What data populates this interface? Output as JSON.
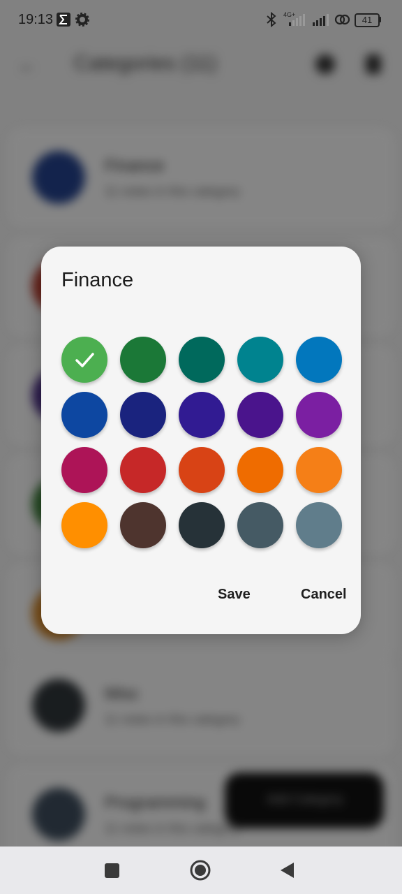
{
  "status_bar": {
    "time": "19:13",
    "battery_level": "41",
    "network_type": "4G+",
    "icons": [
      "sigma-icon",
      "gear-icon",
      "bluetooth-icon",
      "signal-icon",
      "signal-icon",
      "hotspot-icon",
      "battery-icon"
    ]
  },
  "background": {
    "title": "Categories (11)",
    "items": [
      {
        "name": "Finance",
        "subtitle": "11 notes in this category",
        "color": "#24418a"
      },
      {
        "name": "",
        "subtitle": "",
        "color": "#b63b2c"
      },
      {
        "name": "",
        "subtitle": "",
        "color": "#4a2d86"
      },
      {
        "name": "",
        "subtitle": "",
        "color": "#3d7f3a"
      },
      {
        "name": "",
        "subtitle": "",
        "color": "#d7892a"
      },
      {
        "name": "Misc",
        "subtitle": "11 notes in this category",
        "color": "#2f3539"
      },
      {
        "name": "Programming",
        "subtitle": "11 notes in this category",
        "color": "#3d4c5c"
      }
    ],
    "fab_label": "Add Category"
  },
  "dialog": {
    "title": "Finance",
    "selected_index": 0,
    "swatches": [
      "#4caf50",
      "#1b7837",
      "#00695c",
      "#00838f",
      "#0277bd",
      "#0d47a1",
      "#1a237e",
      "#311b92",
      "#4a148c",
      "#7b1fa2",
      "#ad1457",
      "#c62828",
      "#d84315",
      "#ef6c00",
      "#f57f17",
      "#ff8f00",
      "#4e342e",
      "#263238",
      "#455a64",
      "#607d8b"
    ],
    "save_label": "Save",
    "cancel_label": "Cancel"
  },
  "nav_bar": {
    "buttons": [
      "recents-square-icon",
      "home-circle-icon",
      "back-triangle-icon"
    ]
  }
}
